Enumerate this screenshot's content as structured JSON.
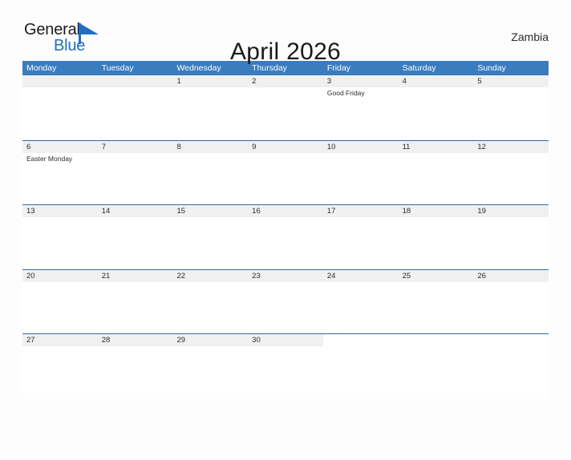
{
  "brand": {
    "name_part1": "General",
    "name_part2": "Blue",
    "flag_icon": "blue-triangle-flag-icon",
    "accent_color": "#1f6fc0"
  },
  "header": {
    "title": "April 2026",
    "country": "Zambia"
  },
  "colors": {
    "weekday_header_bg": "#3a7cbe",
    "week_divider": "#2e6da4",
    "date_strip_bg": "#f0f0f0",
    "page_bg": "#fdfdfd",
    "text": "#2b2b2b"
  },
  "weekdays": [
    "Monday",
    "Tuesday",
    "Wednesday",
    "Thursday",
    "Friday",
    "Saturday",
    "Sunday"
  ],
  "weeks": [
    {
      "days": [
        {
          "date": "",
          "events": [],
          "blank": true
        },
        {
          "date": "",
          "events": [],
          "blank": true
        },
        {
          "date": "1",
          "events": []
        },
        {
          "date": "2",
          "events": []
        },
        {
          "date": "3",
          "events": [
            "Good Friday"
          ]
        },
        {
          "date": "4",
          "events": []
        },
        {
          "date": "5",
          "events": []
        }
      ]
    },
    {
      "days": [
        {
          "date": "6",
          "events": [
            "Easter Monday"
          ]
        },
        {
          "date": "7",
          "events": []
        },
        {
          "date": "8",
          "events": []
        },
        {
          "date": "9",
          "events": []
        },
        {
          "date": "10",
          "events": []
        },
        {
          "date": "11",
          "events": []
        },
        {
          "date": "12",
          "events": []
        }
      ]
    },
    {
      "days": [
        {
          "date": "13",
          "events": []
        },
        {
          "date": "14",
          "events": []
        },
        {
          "date": "15",
          "events": []
        },
        {
          "date": "16",
          "events": []
        },
        {
          "date": "17",
          "events": []
        },
        {
          "date": "18",
          "events": []
        },
        {
          "date": "19",
          "events": []
        }
      ]
    },
    {
      "days": [
        {
          "date": "20",
          "events": []
        },
        {
          "date": "21",
          "events": []
        },
        {
          "date": "22",
          "events": []
        },
        {
          "date": "23",
          "events": []
        },
        {
          "date": "24",
          "events": []
        },
        {
          "date": "25",
          "events": []
        },
        {
          "date": "26",
          "events": []
        }
      ]
    },
    {
      "days": [
        {
          "date": "27",
          "events": []
        },
        {
          "date": "28",
          "events": []
        },
        {
          "date": "29",
          "events": []
        },
        {
          "date": "30",
          "events": []
        },
        {
          "date": "",
          "events": [],
          "blank": true
        },
        {
          "date": "",
          "events": [],
          "blank": true
        },
        {
          "date": "",
          "events": [],
          "blank": true
        }
      ]
    }
  ]
}
